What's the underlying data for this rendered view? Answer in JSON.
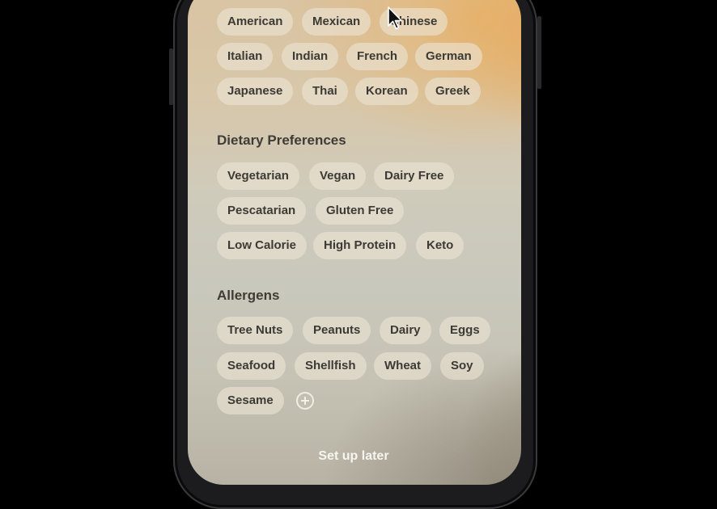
{
  "cuisines": [
    "American",
    "Mexican",
    "Chinese",
    "Italian",
    "Indian",
    "French",
    "German",
    "Japanese",
    "Thai",
    "Korean",
    "Greek"
  ],
  "dietary": {
    "title": "Dietary Preferences",
    "items": [
      "Vegetarian",
      "Vegan",
      "Dairy Free",
      "Pescatarian",
      "Gluten Free",
      "Low Calorie",
      "High Protein",
      "Keto"
    ]
  },
  "allergens": {
    "title": "Allergens",
    "items": [
      "Tree Nuts",
      "Peanuts",
      "Dairy",
      "Eggs",
      "Seafood",
      "Shellfish",
      "Wheat",
      "Soy",
      "Sesame"
    ]
  },
  "setup_later_label": "Set up later",
  "icons": {
    "add": "plus-circle-icon",
    "cursor": "mouse-pointer-icon"
  }
}
